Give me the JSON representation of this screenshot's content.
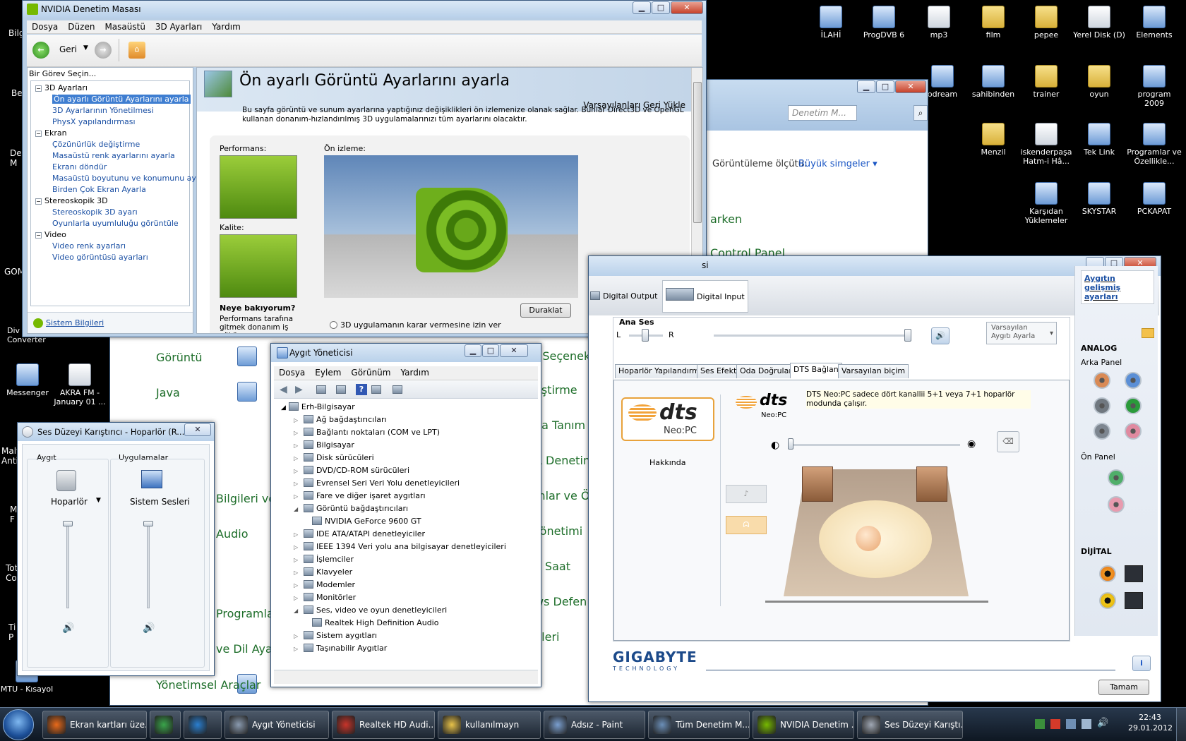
{
  "desktop": {
    "icons_right": [
      {
        "label": "İLAHİ"
      },
      {
        "label": "ProgDVB 6"
      },
      {
        "label": "mp3"
      },
      {
        "label": "film"
      },
      {
        "label": "pepee"
      },
      {
        "label": "Yerel Disk (D)"
      },
      {
        "label": "Elements"
      },
      {
        "label": "odream"
      },
      {
        "label": "sahibinden"
      },
      {
        "label": "trainer"
      },
      {
        "label": "oyun"
      },
      {
        "label": "program 2009"
      },
      {
        "label": "Menzil"
      },
      {
        "label": "iskenderpaşa Hatm-i Hâ..."
      },
      {
        "label": "Tek Link"
      },
      {
        "label": "Programlar ve Özellikle..."
      },
      {
        "label": "Karşıdan Yüklemeler"
      },
      {
        "label": "SKYSTAR"
      },
      {
        "label": "PCKAPAT"
      }
    ],
    "icons_left": [
      {
        "label": "Messenger"
      },
      {
        "label": "AKRA FM - January 01 ..."
      },
      {
        "label": "MTU - Kısayol"
      }
    ],
    "left_fragments": [
      "Bilg",
      "Be",
      "De M",
      "GOM",
      "Div Converter",
      "Malv Anti",
      "M F",
      "Tot Co",
      "Ti P"
    ]
  },
  "control_panel_bg": {
    "search_placeholder": "Denetim M...",
    "view_label": "Görüntüleme ölçütü:",
    "view_value": "Büyük simgeler",
    "fragment_arken": "arken",
    "fragment_cp": "Control Panel",
    "items_left": [
      "Görüntü",
      "Java",
      "Bilgileri ve",
      "Audio",
      "Programlar",
      "ve Dil Ayarı",
      "Yönetimsel Araçlar"
    ],
    "items_right": [
      "t Seçenek",
      "eştirme",
      "na Tanım",
      "A Denetim",
      "mlar ve Ö",
      "Yönetimi",
      "e Saat",
      "ws Defen",
      "pleri"
    ]
  },
  "nvidia": {
    "title": "NVIDIA Denetim Masası",
    "menu": [
      "Dosya",
      "Düzen",
      "Masaüstü",
      "3D Ayarları",
      "Yardım"
    ],
    "back_label": "Geri",
    "task_label": "Bir Görev Seçin...",
    "tree": [
      {
        "label": "3D Ayarları",
        "level": 0
      },
      {
        "label": "Ön ayarlı Görüntü Ayarlarını ayarla",
        "level": 1,
        "selected": true
      },
      {
        "label": "3D Ayarlarının Yönetilmesi",
        "level": 1
      },
      {
        "label": "PhysX yapılandırması",
        "level": 1
      },
      {
        "label": "Ekran",
        "level": 0
      },
      {
        "label": "Çözünürlük değiştirme",
        "level": 1
      },
      {
        "label": "Masaüstü renk ayarlarını ayarla",
        "level": 1
      },
      {
        "label": "Ekranı döndür",
        "level": 1
      },
      {
        "label": "Masaüstü boyutunu ve konumunu ayarla",
        "level": 1
      },
      {
        "label": "Birden Çok Ekran Ayarla",
        "level": 1
      },
      {
        "label": "Stereoskopik 3D",
        "level": 0
      },
      {
        "label": "Stereoskopik 3D ayarı",
        "level": 1
      },
      {
        "label": "Oyunlarla uyumluluğu görüntüle",
        "level": 1
      },
      {
        "label": "Video",
        "level": 0
      },
      {
        "label": "Video renk ayarları",
        "level": 1
      },
      {
        "label": "Video görüntüsü ayarları",
        "level": 1
      }
    ],
    "system_info": "Sistem Bilgileri",
    "heading": "Ön ayarlı Görüntü Ayarlarını ayarla",
    "restore": "Varsayılanları Geri Yükle",
    "description": "Bu sayfa görüntü ve sunum ayarlarına yaptığınız değişiklikleri ön izlemenize olanak sağlar. Bunlar Direct3D ve OpenGL kullanan donanım-hızlandırılmış 3D uygulamalarınızı tüm ayarlarını olacaktır.",
    "performance_label": "Performans:",
    "quality_label": "Kalite:",
    "preview_label": "Ön izleme:",
    "pause_button": "Duraklat",
    "looking_label": "Neye bakıyorum?",
    "looking_text": "Performans tarafına gitmek donanım iş yükü",
    "radio_label": "3D uygulamanın karar vermesine izin ver"
  },
  "devmgr": {
    "title": "Aygıt Yöneticisi",
    "menu": [
      "Dosya",
      "Eylem",
      "Görünüm",
      "Yardım"
    ],
    "root": "Erh-Bilgisayar",
    "items": [
      {
        "label": "Ağ bağdaştırıcıları",
        "expanded": false
      },
      {
        "label": "Bağlantı noktaları (COM ve LPT)",
        "expanded": false
      },
      {
        "label": "Bilgisayar",
        "expanded": false
      },
      {
        "label": "Disk sürücüleri",
        "expanded": false
      },
      {
        "label": "DVD/CD-ROM sürücüleri",
        "expanded": false
      },
      {
        "label": "Evrensel Seri Veri Yolu denetleyicileri",
        "expanded": false
      },
      {
        "label": "Fare ve diğer işaret aygıtları",
        "expanded": false
      },
      {
        "label": "Görüntü bağdaştırıcıları",
        "expanded": true
      },
      {
        "label": "NVIDIA GeForce 9600 GT",
        "child": true
      },
      {
        "label": "IDE ATA/ATAPI denetleyiciler",
        "expanded": false
      },
      {
        "label": "IEEE 1394 Veri yolu ana bilgisayar denetleyicileri",
        "expanded": false
      },
      {
        "label": "İşlemciler",
        "expanded": false
      },
      {
        "label": "Klavyeler",
        "expanded": false
      },
      {
        "label": "Modemler",
        "expanded": false
      },
      {
        "label": "Monitörler",
        "expanded": false
      },
      {
        "label": "Ses, video ve oyun denetleyicileri",
        "expanded": true
      },
      {
        "label": "Realtek High Definition Audio",
        "child": true
      },
      {
        "label": "Sistem aygıtları",
        "expanded": false
      },
      {
        "label": "Taşınabilir Aygıtlar",
        "expanded": false
      }
    ]
  },
  "mixer": {
    "title": "Ses Düzeyi Karıştırıcı - Hoparlör (R...",
    "device_header": "Aygıt",
    "apps_header": "Uygulamalar",
    "device_name": "Hoparlör",
    "app_name": "Sistem Sesleri",
    "device_level": 1.0,
    "app_level": 1.0
  },
  "realtek": {
    "title_fragment": "si",
    "digital_output": "Digital Output",
    "digital_input": "Digital Input",
    "adv_link": "Aygıtın gelişmiş ayarları",
    "master_label": "Ana Ses",
    "left": "L",
    "right": "R",
    "default_device": "Varsayılan Aygıtı Ayarla",
    "tabs": [
      "Hoparlör Yapılandırması",
      "Ses Efekti",
      "Oda Doğrulaması",
      "DTS Bağlan",
      "Varsayılan biçim"
    ],
    "active_tab": 3,
    "dts_text": "dts",
    "neo_pc": "Neo:PC",
    "about": "Hakkında",
    "dts_description": "DTS Neo:PC sadece dört kanallii 5+1 veya 7+1 hoparlör modunda çalışır.",
    "analog_label": "ANALOG",
    "back_panel": "Arka Panel",
    "front_panel": "Ön Panel",
    "digital_label": "DİJİTAL",
    "brand": "GIGABYTE",
    "brand_sub": "TECHNOLOGY",
    "ok_button": "Tamam",
    "jack_colors": [
      "#d98a55",
      "#5b8fd6",
      "#707880",
      "#2a9a3a",
      "#7d8690",
      "#e08aa0"
    ],
    "front_jack_colors": [
      "#4fae6a",
      "#e89aae"
    ]
  },
  "taskbar": {
    "items": [
      "Ekran kartları üze...",
      "",
      "",
      "Aygıt Yöneticisi",
      "Realtek HD Audi...",
      "kullanılmayn",
      "Adsız - Paint",
      "Tüm Denetim M...",
      "NVIDIA Denetim ...",
      "Ses Düzeyi Karıştı..."
    ],
    "clock_time": "22:43",
    "clock_date": "29.01.2012"
  }
}
